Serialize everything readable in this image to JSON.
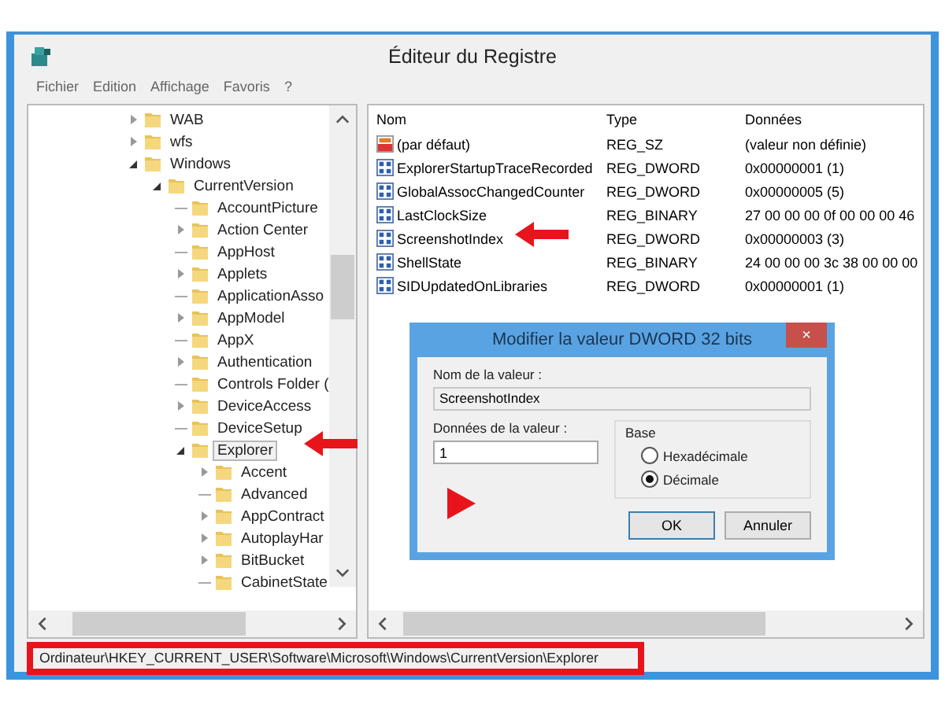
{
  "window": {
    "title": "Éditeur du Registre"
  },
  "menu": [
    "Fichier",
    "Edition",
    "Affichage",
    "Favoris",
    "?"
  ],
  "tree": [
    {
      "label": "WAB",
      "expandable": true,
      "expanded": false,
      "selected": false
    },
    {
      "label": "wfs",
      "expandable": true,
      "expanded": false,
      "selected": false
    },
    {
      "label": "Windows",
      "expandable": true,
      "expanded": true,
      "selected": false,
      "children": [
        {
          "label": "CurrentVersion",
          "expandable": true,
          "expanded": true,
          "selected": false,
          "children": [
            {
              "label": "AccountPicture",
              "expandable": false,
              "selected": false
            },
            {
              "label": "Action Center",
              "expandable": true,
              "expanded": false,
              "selected": false
            },
            {
              "label": "AppHost",
              "expandable": false,
              "selected": false
            },
            {
              "label": "Applets",
              "expandable": true,
              "expanded": false,
              "selected": false
            },
            {
              "label": "ApplicationAsso",
              "expandable": false,
              "selected": false
            },
            {
              "label": "AppModel",
              "expandable": true,
              "expanded": false,
              "selected": false
            },
            {
              "label": "AppX",
              "expandable": false,
              "selected": false
            },
            {
              "label": "Authentication",
              "expandable": true,
              "expanded": false,
              "selected": false
            },
            {
              "label": "Controls Folder (",
              "expandable": false,
              "selected": false
            },
            {
              "label": "DeviceAccess",
              "expandable": true,
              "expanded": false,
              "selected": false
            },
            {
              "label": "DeviceSetup",
              "expandable": false,
              "selected": false
            },
            {
              "label": "Explorer",
              "expandable": true,
              "expanded": true,
              "selected": true,
              "children": [
                {
                  "label": "Accent",
                  "expandable": true,
                  "expanded": false,
                  "selected": false
                },
                {
                  "label": "Advanced",
                  "expandable": false,
                  "selected": false
                },
                {
                  "label": "AppContract",
                  "expandable": true,
                  "expanded": false,
                  "selected": false
                },
                {
                  "label": "AutoplayHar",
                  "expandable": true,
                  "expanded": false,
                  "selected": false
                },
                {
                  "label": "BitBucket",
                  "expandable": true,
                  "expanded": false,
                  "selected": false
                },
                {
                  "label": "CabinetState",
                  "expandable": false,
                  "selected": false
                }
              ]
            }
          ]
        }
      ]
    }
  ],
  "table": {
    "columns": [
      "Nom",
      "Type",
      "Données"
    ],
    "rows": [
      {
        "kind": "string",
        "name": "(par défaut)",
        "type": "REG_SZ",
        "data": "(valeur non définie)"
      },
      {
        "kind": "binary",
        "name": "ExplorerStartupTraceRecorded",
        "type": "REG_DWORD",
        "data": "0x00000001 (1)"
      },
      {
        "kind": "binary",
        "name": "GlobalAssocChangedCounter",
        "type": "REG_DWORD",
        "data": "0x00000005 (5)"
      },
      {
        "kind": "binary",
        "name": "LastClockSize",
        "type": "REG_BINARY",
        "data": "27 00 00 00 0f 00 00 00 46"
      },
      {
        "kind": "binary",
        "name": "ScreenshotIndex",
        "type": "REG_DWORD",
        "data": "0x00000003 (3)"
      },
      {
        "kind": "binary",
        "name": "ShellState",
        "type": "REG_BINARY",
        "data": "24 00 00 00 3c 38 00 00 00"
      },
      {
        "kind": "binary",
        "name": "SIDUpdatedOnLibraries",
        "type": "REG_DWORD",
        "data": "0x00000001 (1)"
      }
    ]
  },
  "dialog": {
    "title": "Modifier la valeur DWORD 32 bits",
    "close": "×",
    "name_label": "Nom de la valeur :",
    "name_value": "ScreenshotIndex",
    "data_label": "Données de la valeur :",
    "data_value": "1",
    "base_label": "Base",
    "radios": [
      {
        "label": "Hexadécimale",
        "selected": false
      },
      {
        "label": "Décimale",
        "selected": true
      }
    ],
    "buttons": [
      "OK",
      "Annuler"
    ]
  },
  "status_bar": "Ordinateur\\HKEY_CURRENT_USER\\Software\\Microsoft\\Windows\\CurrentVersion\\Explorer"
}
